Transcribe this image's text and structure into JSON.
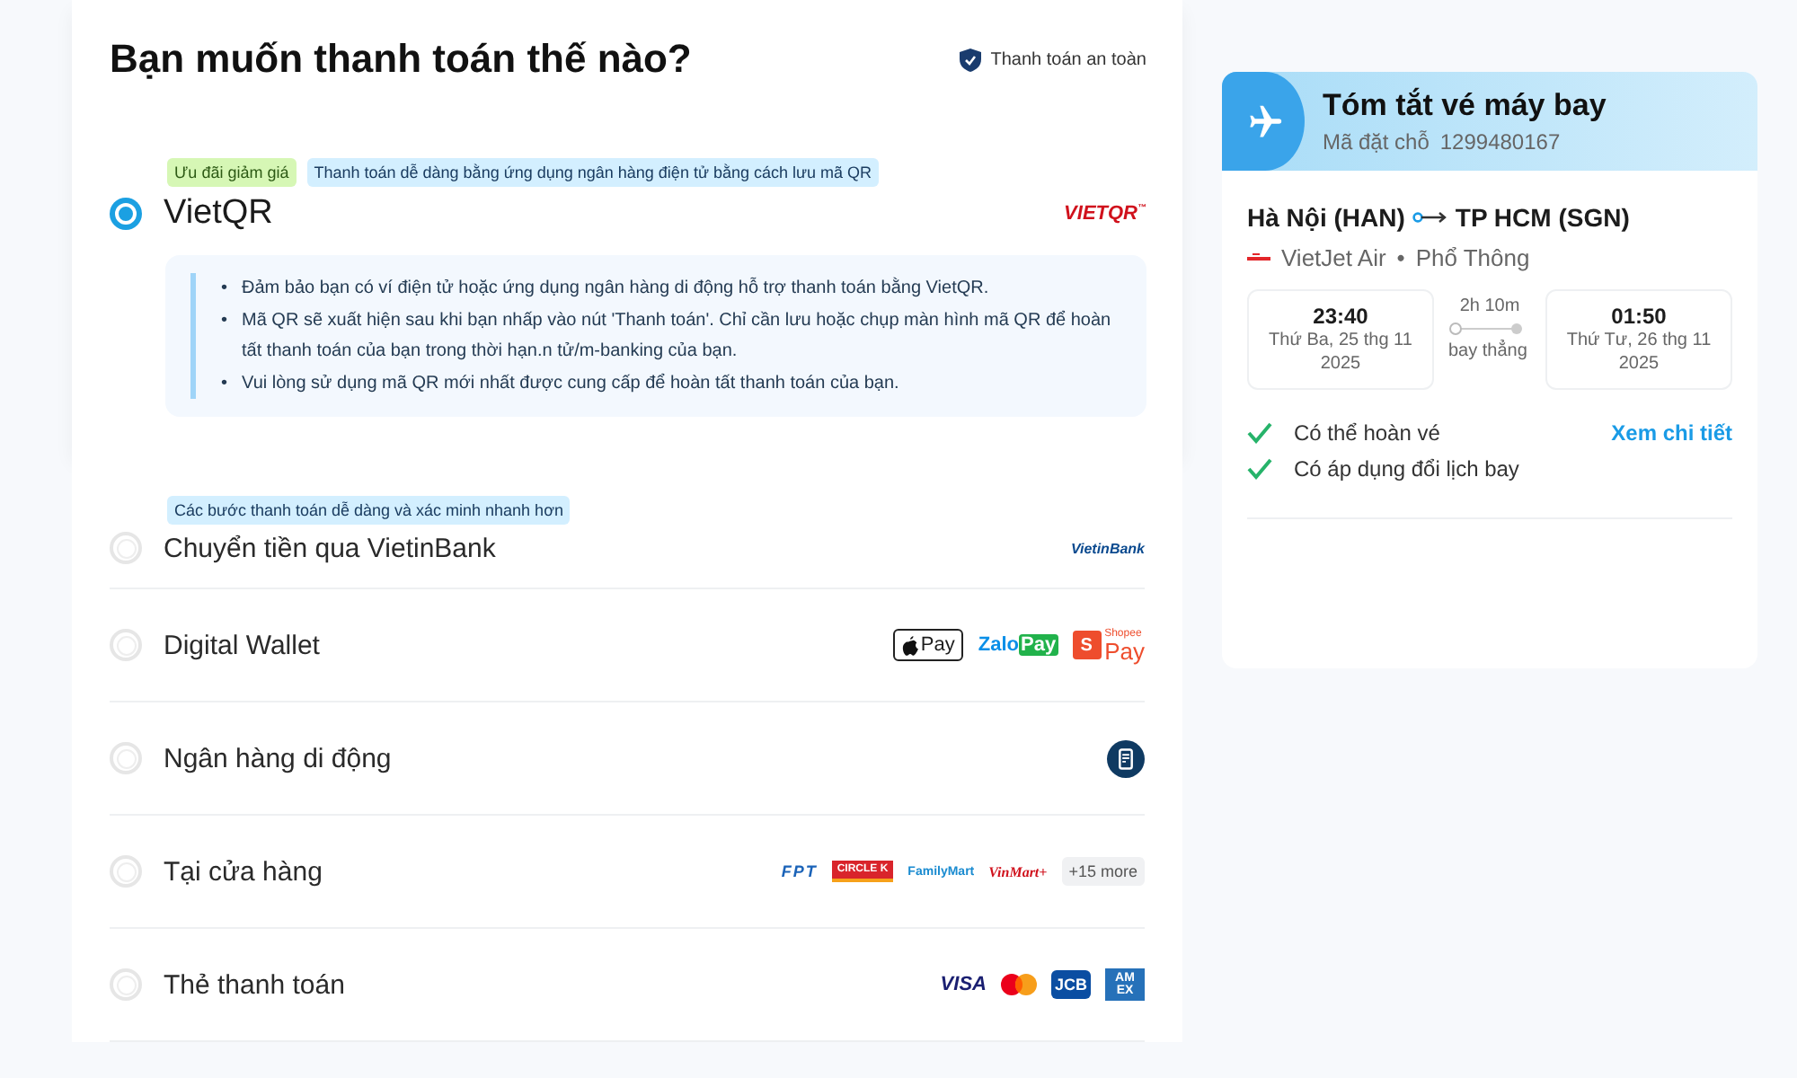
{
  "header": {
    "title": "Bạn muốn thanh toán thế nào?",
    "secure_badge": "Thanh toán an toàn"
  },
  "methods": [
    {
      "label": "VietQR",
      "selected": true,
      "note_bullet": "•",
      "tags": [
        {
          "text": "Ưu đãi giảm giá",
          "kind": "promo"
        },
        {
          "text": "Thanh toán dễ dàng bằng ứng dụng ngân hàng điện tử bằng cách lưu mã QR",
          "kind": "info"
        }
      ],
      "logos": [
        {
          "kind": "vietqr",
          "text": "VIETQR",
          "text2": "™"
        }
      ],
      "notes": [
        "Đảm bảo bạn có ví điện tử hoặc ứng dụng ngân hàng di động hỗ trợ thanh toán bằng VietQR.",
        "Mã QR sẽ xuất hiện sau khi bạn nhấp vào nút 'Thanh toán'. Chỉ cần lưu hoặc chụp màn hình mã QR để hoàn tất thanh toán của bạn trong thời hạn.n tử/m-banking của bạn.",
        "Vui lòng sử dụng mã QR mới nhất được cung cấp để hoàn tất thanh toán của bạn."
      ]
    },
    {
      "label": "Chuyển tiền qua VietinBank",
      "selected": false,
      "tags": [
        {
          "text": "Các bước thanh toán dễ dàng và xác minh nhanh hơn",
          "kind": "info"
        }
      ],
      "logos": [
        {
          "kind": "vietinbank",
          "text": "VietinBank"
        }
      ]
    },
    {
      "label": "Digital Wallet",
      "selected": false,
      "logos": [
        {
          "kind": "applepay",
          "text": "Pay"
        },
        {
          "kind": "zalopay",
          "text": "Zalo",
          "text2": "Pay"
        },
        {
          "kind": "shopeepay",
          "text": "Pay",
          "text2": "Shopee",
          "text3": "S"
        }
      ]
    },
    {
      "label": "Ngân hàng di động",
      "selected": false,
      "logos": [
        {
          "kind": "mobilebank"
        }
      ]
    },
    {
      "label": "Tại cửa hàng",
      "selected": false,
      "logos": [
        {
          "kind": "fpt",
          "text": "FPT"
        },
        {
          "kind": "circlek",
          "text": "CIRCLE K"
        },
        {
          "kind": "familymart",
          "text": "FamilyMart"
        },
        {
          "kind": "vinmart",
          "text": "VinMart+"
        },
        {
          "kind": "more",
          "text": "+15 more"
        }
      ]
    },
    {
      "label": "Thẻ thanh toán",
      "selected": false,
      "logos": [
        {
          "kind": "visa",
          "text": "VISA"
        },
        {
          "kind": "mastercard"
        },
        {
          "kind": "jcb",
          "text": "JCB"
        },
        {
          "kind": "amex",
          "text": "AM",
          "text2": "EX"
        }
      ]
    }
  ],
  "summary": {
    "title": "Tóm tắt vé máy bay",
    "booking_label": "Mã đặt chỗ",
    "booking_code": "1299480167",
    "origin": "Hà Nội (HAN)",
    "destination": "TP HCM (SGN)",
    "airline": "VietJet Air",
    "separator": "•",
    "cabin": "Phổ Thông",
    "departure": {
      "time": "23:40",
      "date": "Thứ Ba, 25 thg 11 2025"
    },
    "duration": "2h 10m",
    "stops": "bay thẳng",
    "arrival": {
      "time": "01:50",
      "date": "Thứ Tư, 26 thg 11 2025"
    },
    "features": [
      "Có thể hoàn vé",
      "Có áp dụng đổi lịch bay"
    ],
    "details_link": "Xem chi tiết"
  }
}
